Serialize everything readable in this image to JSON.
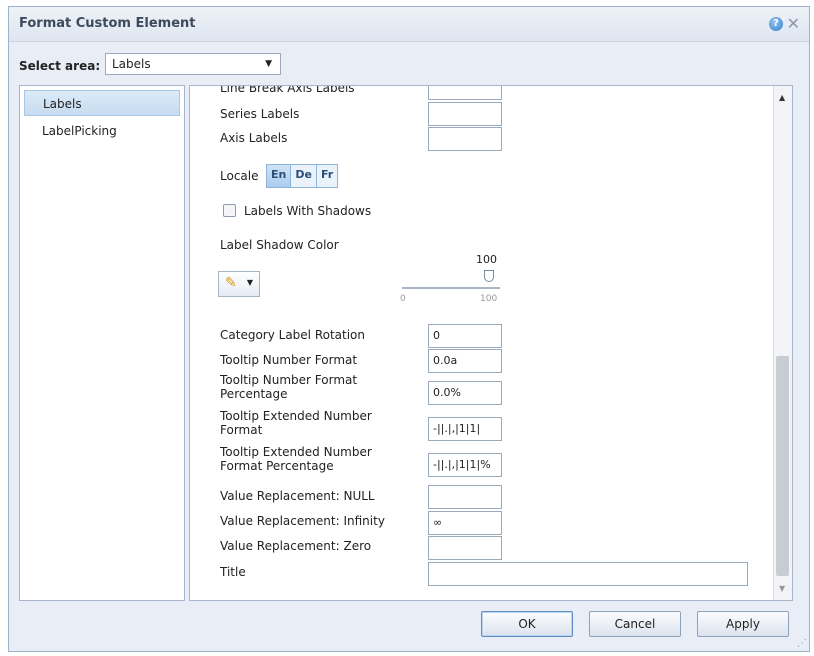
{
  "dialog": {
    "title": "Format Custom Element",
    "help_icon": "?",
    "close_icon": "✕"
  },
  "select_area": {
    "label": "Select area:",
    "value": "Labels",
    "arrow": "▼"
  },
  "nav": {
    "items": [
      {
        "label": "Labels"
      },
      {
        "label": "LabelPicking"
      }
    ]
  },
  "labels": {
    "cut_off_row": "Line Break Axis Labels",
    "series_labels": "Series Labels",
    "axis_labels": "Axis Labels",
    "locale_label": "Locale",
    "locale_options": [
      "En",
      "De",
      "Fr"
    ],
    "labels_with_shadows": "Labels With Shadows",
    "label_shadow_color": "Label Shadow Color",
    "slider": {
      "value": "100",
      "min": "0",
      "max": "100"
    },
    "category_label_rotation": {
      "label": "Category Label Rotation",
      "value": "0"
    },
    "tooltip_number_format": {
      "label": "Tooltip Number Format",
      "value": "0.0a"
    },
    "tooltip_number_format_percentage": {
      "label_line1": "Tooltip Number Format",
      "label_line2": "Percentage",
      "value": "0.0%"
    },
    "tooltip_extended_number_format": {
      "label_line1": "Tooltip Extended Number",
      "label_line2": "Format",
      "value": "-||.|,|1|1|"
    },
    "tooltip_extended_number_format_percentage": {
      "label_line1": "Tooltip Extended Number",
      "label_line2": "Format Percentage",
      "value": "-||.|,|1|1|%"
    },
    "value_replacement_null": {
      "label": "Value Replacement: NULL",
      "value": ""
    },
    "value_replacement_infinity": {
      "label": "Value Replacement: Infinity",
      "value": "∞"
    },
    "value_replacement_zero": {
      "label": "Value Replacement: Zero",
      "value": ""
    },
    "title": {
      "label": "Title",
      "value": ""
    }
  },
  "buttons": {
    "ok": "OK",
    "cancel": "Cancel",
    "apply": "Apply"
  }
}
